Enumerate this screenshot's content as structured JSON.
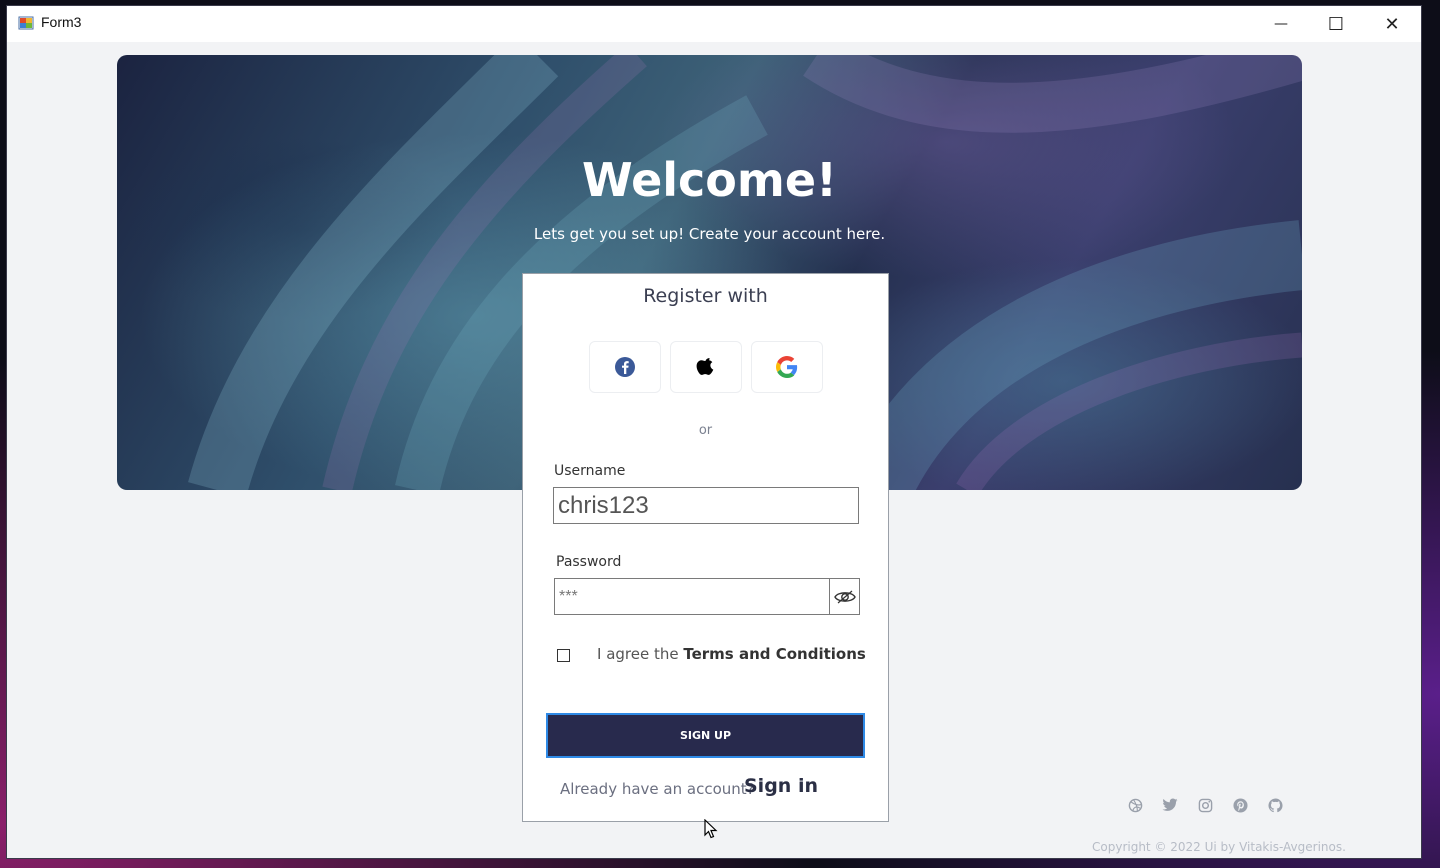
{
  "window": {
    "title": "Form3",
    "minimize_symbol": "—",
    "maximize_symbol": "☐",
    "close_symbol": "✕"
  },
  "hero": {
    "title": "Welcome!",
    "subtitle": "Lets get you set up! Create your account here."
  },
  "register": {
    "title": "Register with",
    "social": [
      {
        "name": "facebook-icon",
        "color": "#3b5998"
      },
      {
        "name": "apple-icon",
        "color": "#000000"
      },
      {
        "name": "google-icon",
        "color": "#4285F4"
      }
    ],
    "or_label": "or"
  },
  "form": {
    "username_label": "Username",
    "username_value": "chris123",
    "password_label": "Password",
    "password_value": "***",
    "agree_prefix": "I agree the ",
    "agree_link": "Terms and Conditions",
    "agree_checked": false,
    "signup_label": "SIGN UP",
    "already_text": "Already have an account?",
    "signin_label": "Sign in"
  },
  "footer": {
    "icons": [
      "dribbble-icon",
      "twitter-icon",
      "instagram-icon",
      "pinterest-icon",
      "github-icon"
    ],
    "copyright": "Copyright © 2022 Ui by Vitakis-Avgerinos."
  },
  "colors": {
    "button_bg": "#282a4d",
    "button_border": "#2f8ae6",
    "footer_icon": "#9aa0ab"
  }
}
